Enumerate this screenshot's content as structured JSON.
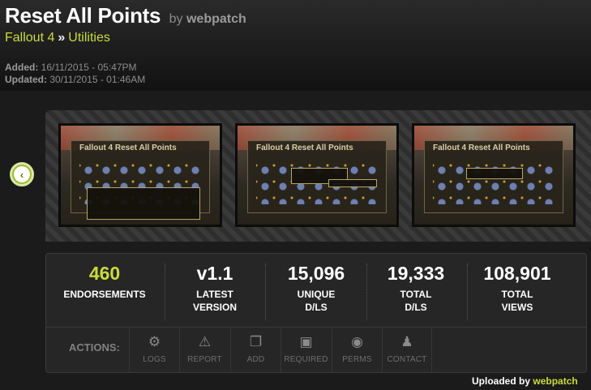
{
  "header": {
    "title": "Reset All Points",
    "by_text": "by",
    "author": "webpatch",
    "breadcrumb": [
      "Fallout 4",
      "Utilities"
    ],
    "breadcrumb_sep": "»",
    "added_label": "Added:",
    "added_value": "16/11/2015 - 05:47PM",
    "updated_label": "Updated:",
    "updated_value": "30/11/2015 - 01:46AM"
  },
  "gallery": {
    "thumbnails": [
      {
        "title": "Fallout 4 Reset All Points"
      },
      {
        "title": "Fallout 4 Reset All Points"
      },
      {
        "title": "Fallout 4 Reset All Points"
      }
    ]
  },
  "stats": [
    {
      "value": "460",
      "label_line1": "ENDORSEMENTS",
      "label_line2": "",
      "highlight": "#c7dd3c"
    },
    {
      "value": "v1.1",
      "label_line1": "LATEST",
      "label_line2": "VERSION"
    },
    {
      "value": "15,096",
      "label_line1": "UNIQUE",
      "label_line2": "D/LS"
    },
    {
      "value": "19,333",
      "label_line1": "TOTAL",
      "label_line2": "D/LS"
    },
    {
      "value": "108,901",
      "label_line1": "TOTAL",
      "label_line2": "VIEWS"
    }
  ],
  "actions": {
    "label": "ACTIONS:",
    "items": [
      {
        "label": "LOGS",
        "icon": "gear-icon"
      },
      {
        "label": "REPORT",
        "icon": "warning-icon"
      },
      {
        "label": "ADD",
        "icon": "windows-icon"
      },
      {
        "label": "REQUIRED",
        "icon": "floppy-icon"
      },
      {
        "label": "PERMS",
        "icon": "permissions-icon"
      },
      {
        "label": "CONTACT",
        "icon": "person-icon"
      }
    ]
  },
  "footer": {
    "uploaded_by_label": "Uploaded by",
    "uploader": "webpatch"
  }
}
